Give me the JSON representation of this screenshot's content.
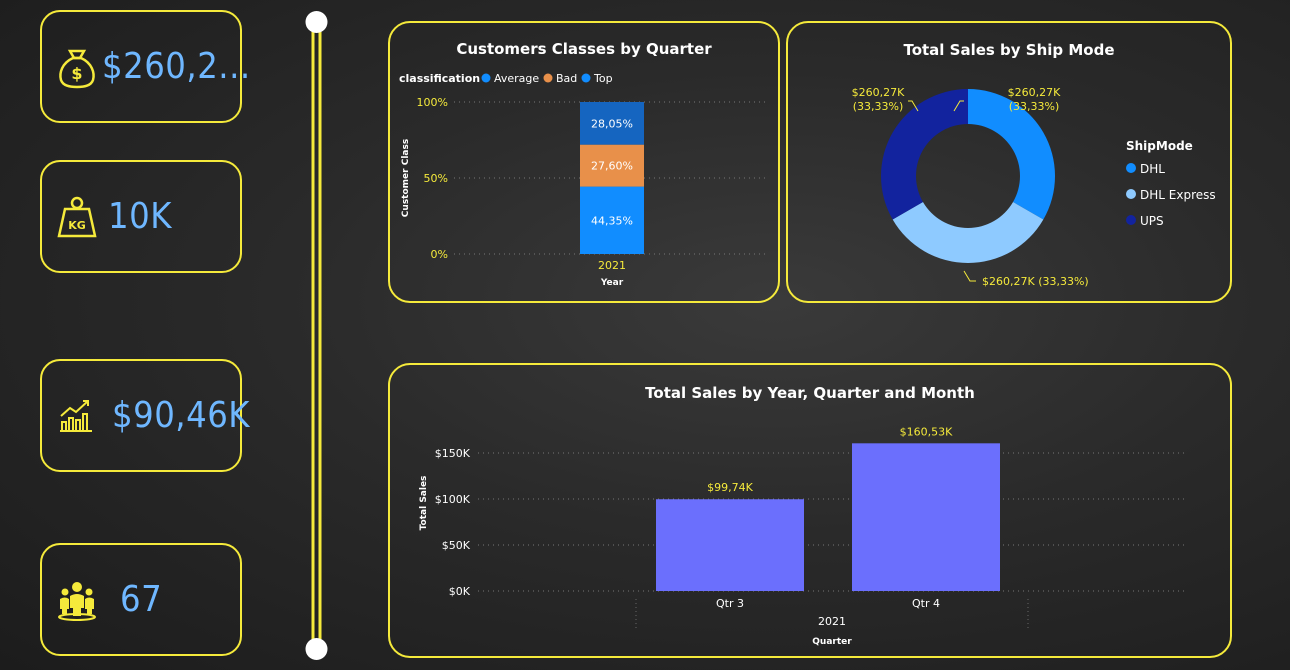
{
  "kpis": {
    "total_sales": "$260,2...",
    "weight": "10K",
    "profit": "$90,46K",
    "customers": "67"
  },
  "class_chart": {
    "title": "Customers Classes by Quarter",
    "legend_title": "classification",
    "ylabel": "Customer Class",
    "xlabel": "Year",
    "ticks": [
      "100%",
      "50%",
      "0%"
    ],
    "category": "2021"
  },
  "ship_chart": {
    "title": "Total Sales by Ship Mode",
    "legend_title": "ShipMode",
    "label_1_value": "$260,27K",
    "label_1_pct": "(33,33%)",
    "label_2_value": "$260,27K",
    "label_2_pct": "(33,33%)",
    "label_3": "$260,27K (33,33%)"
  },
  "sales_chart": {
    "title": "Total Sales by Year, Quarter and Month",
    "ylabel": "Total Sales",
    "xlabel": "Quarter",
    "year_label": "2021",
    "ticks": [
      "$150K",
      "$100K",
      "$50K",
      "$0K"
    ]
  },
  "chart_data": [
    {
      "type": "bar",
      "stacked": true,
      "title": "Customers Classes by Quarter",
      "xlabel": "Year",
      "ylabel": "Customer Class",
      "categories": [
        "2021"
      ],
      "ylim": [
        0,
        100
      ],
      "series": [
        {
          "name": "Average",
          "values": [
            44.35
          ],
          "label": "44,35%",
          "color": "#118dff"
        },
        {
          "name": "Bad",
          "values": [
            27.6
          ],
          "label": "27,60%",
          "color": "#e8904a"
        },
        {
          "name": "Top",
          "values": [
            28.05
          ],
          "label": "28,05%",
          "color": "#1565c0"
        }
      ]
    },
    {
      "type": "pie",
      "title": "Total Sales by Ship Mode",
      "categories": [
        "DHL",
        "DHL Express",
        "UPS"
      ],
      "values": [
        260.27,
        260.27,
        260.27
      ],
      "colors": [
        "#118dff",
        "#8ecaff",
        "#12239e"
      ]
    },
    {
      "type": "bar",
      "title": "Total Sales by Year, Quarter and Month",
      "xlabel": "Quarter",
      "ylabel": "Total Sales",
      "categories": [
        "Qtr 3",
        "Qtr 4"
      ],
      "values": [
        99.74,
        160.53
      ],
      "labels": [
        "$99,74K",
        "$160,53K"
      ],
      "ylim": [
        0,
        150
      ],
      "color": "#6b6ffd"
    }
  ]
}
